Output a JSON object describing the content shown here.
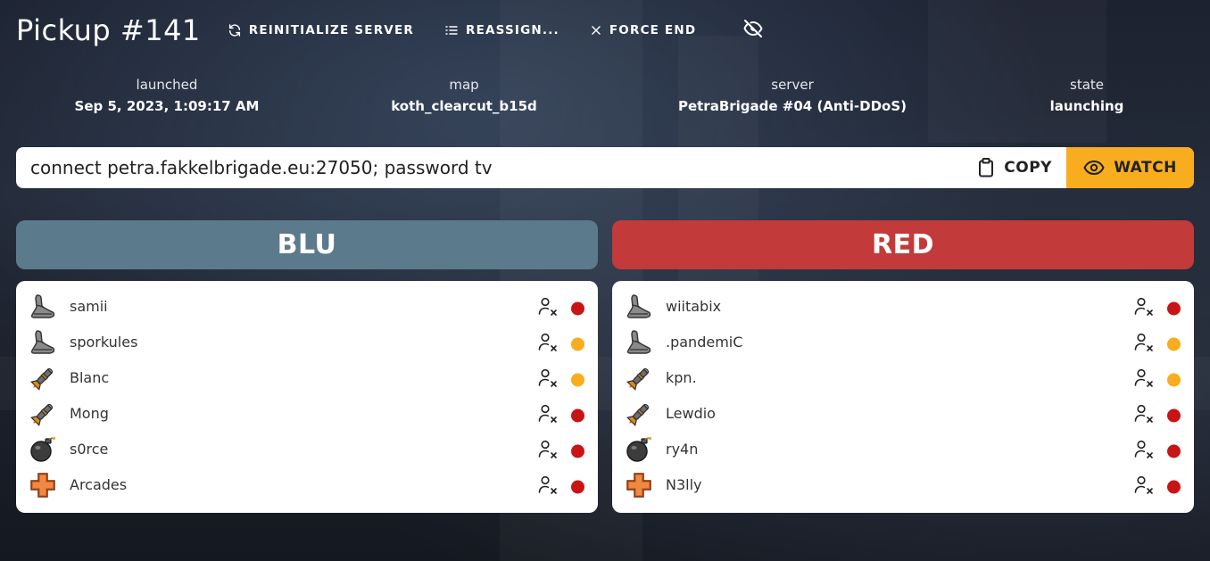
{
  "header": {
    "title": "Pickup #141",
    "actions": [
      {
        "label": "REINITIALIZE SERVER",
        "icon": "refresh-icon"
      },
      {
        "label": "REASSIGN...",
        "icon": "list-icon"
      },
      {
        "label": "FORCE END",
        "icon": "close-icon"
      }
    ],
    "hide_icon": "eye-off-icon"
  },
  "meta": {
    "launched": {
      "label": "launched",
      "value": "Sep 5, 2023, 1:09:17 AM"
    },
    "map": {
      "label": "map",
      "value": "koth_clearcut_b15d"
    },
    "server": {
      "label": "server",
      "value": "PetraBrigade #04 (Anti-DDoS)"
    },
    "state": {
      "label": "state",
      "value": "launching"
    }
  },
  "connect": {
    "text": "connect petra.fakkelbrigade.eu:27050; password tv",
    "copy_label": "COPY",
    "watch_label": "WATCH"
  },
  "colors": {
    "blu": "#5b7a8c",
    "red": "#c23a3a",
    "accent": "#f8ad1e",
    "status_red": "#c81414",
    "status_yellow": "#f7ad1e"
  },
  "teams": {
    "blu": {
      "label": "BLU",
      "players": [
        {
          "name": "samii",
          "class": "scout",
          "status": "red"
        },
        {
          "name": "sporkules",
          "class": "scout",
          "status": "yellow"
        },
        {
          "name": "Blanc",
          "class": "soldier",
          "status": "yellow"
        },
        {
          "name": "Mong",
          "class": "soldier",
          "status": "red"
        },
        {
          "name": "s0rce",
          "class": "demoman",
          "status": "red"
        },
        {
          "name": "Arcades",
          "class": "medic",
          "status": "red"
        }
      ]
    },
    "red": {
      "label": "RED",
      "players": [
        {
          "name": "wiitabix",
          "class": "scout",
          "status": "red"
        },
        {
          "name": ".pandemiC",
          "class": "scout",
          "status": "yellow"
        },
        {
          "name": "kpn.",
          "class": "soldier",
          "status": "yellow"
        },
        {
          "name": "Lewdio",
          "class": "soldier",
          "status": "red"
        },
        {
          "name": "ry4n",
          "class": "demoman",
          "status": "red"
        },
        {
          "name": "N3lly",
          "class": "medic",
          "status": "red"
        }
      ]
    }
  }
}
